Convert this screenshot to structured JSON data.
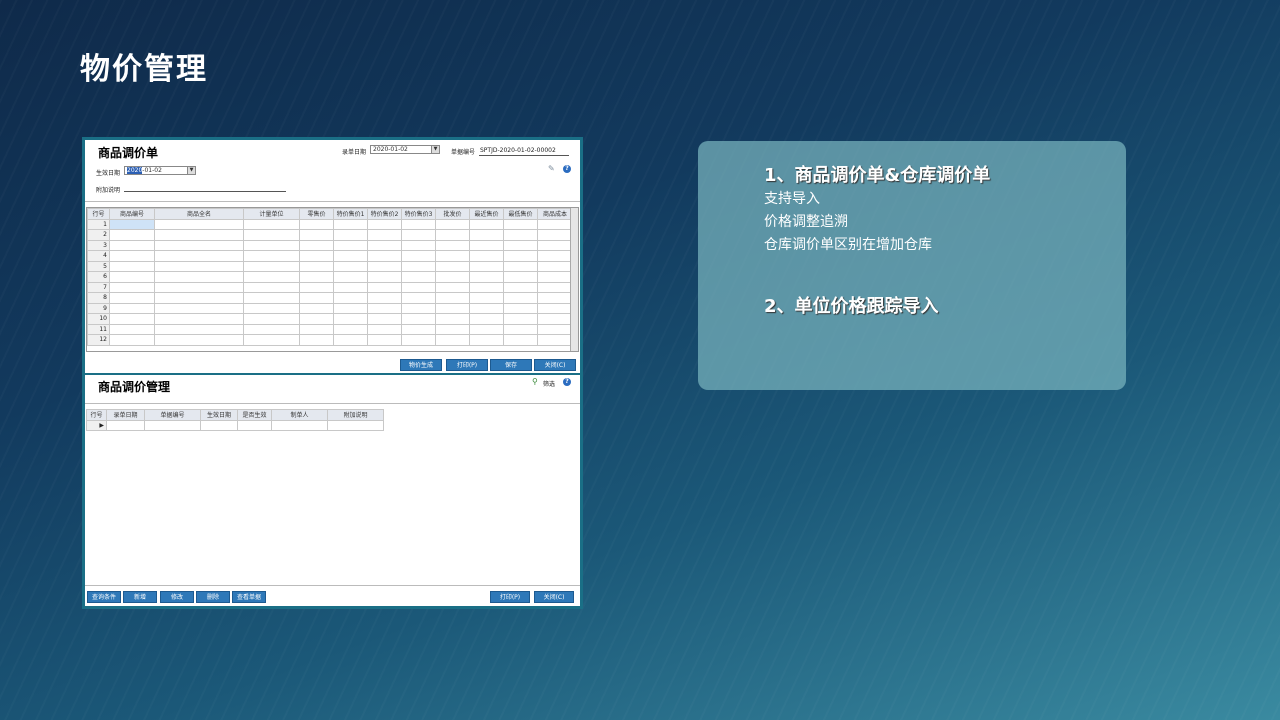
{
  "slide": {
    "title": "物价管理"
  },
  "top_window": {
    "title": "商品调价单",
    "entry_date_label": "录单日期",
    "entry_date_value": "2020-01-02",
    "doc_no_label": "单据编号",
    "doc_no_value": "SPTJD-2020-01-02-00002",
    "effective_date_label": "生效日期",
    "effective_date_value": "2020-01-02",
    "effective_date_highlight": "2020",
    "note_label": "附加说明",
    "columns": [
      "行号",
      "商品编号",
      "商品全名",
      "计量单位",
      "零售价",
      "特价售价1",
      "特价售价2",
      "特价售价3",
      "批发价",
      "最近售价",
      "最低售价",
      "商品成本"
    ],
    "rows": [
      "1",
      "2",
      "3",
      "4",
      "5",
      "6",
      "7",
      "8",
      "9",
      "10",
      "11",
      "12"
    ],
    "buttons": {
      "generate": "物价生成",
      "print": "打印(P)",
      "save": "保存",
      "close": "关闭(C)"
    }
  },
  "bottom_window": {
    "title": "商品调价管理",
    "filter_label": "筛选",
    "columns": [
      "行号",
      "录单日期",
      "单据编号",
      "生效日期",
      "是否生效",
      "制单人",
      "附加说明"
    ],
    "buttons": {
      "query": "查询条件",
      "add": "新增",
      "edit": "修改",
      "delete": "删除",
      "view": "查看单据",
      "print": "打印(P)",
      "close": "关闭(C)"
    }
  },
  "panel": {
    "heading1": "1、商品调价单&仓库调价单",
    "items": [
      "支持导入",
      "价格调整追溯",
      "仓库调价单区别在增加仓库"
    ],
    "heading2": "2、单位价格跟踪导入"
  },
  "colors": {
    "frame": "#1a6f86",
    "button": "#2e78b8",
    "panel": "#78b4be"
  }
}
